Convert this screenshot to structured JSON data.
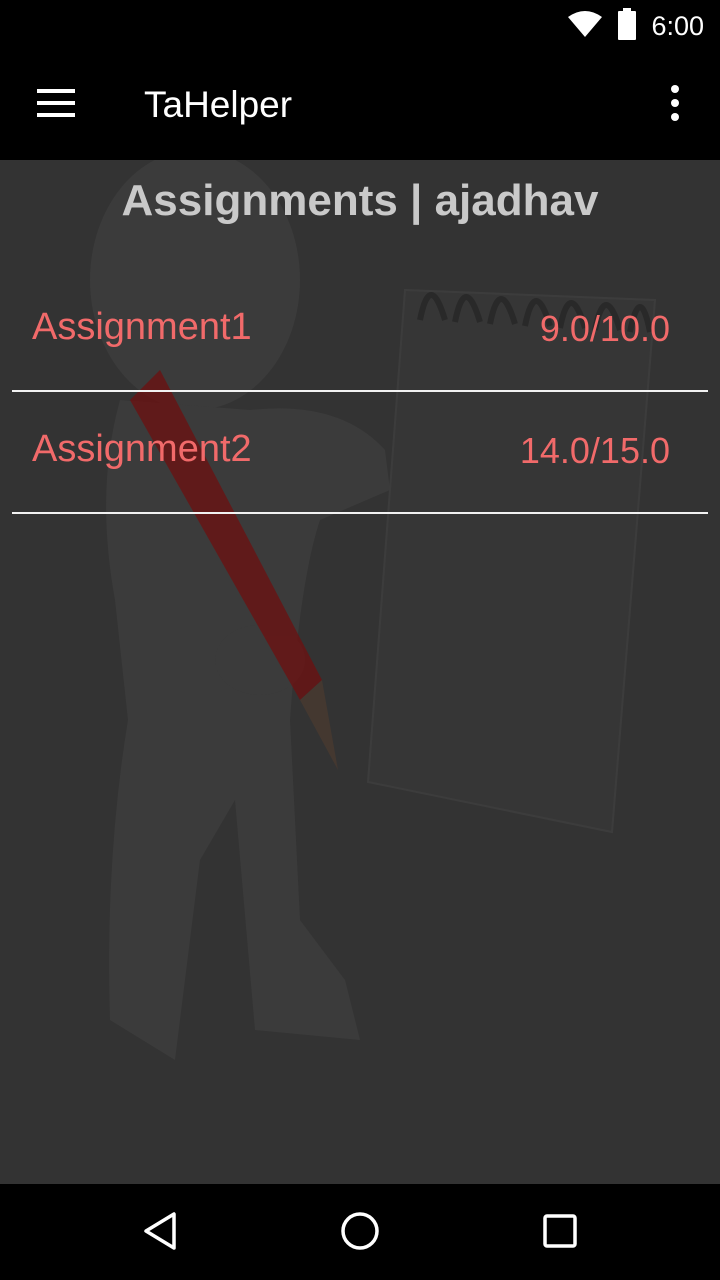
{
  "status_bar": {
    "time": "6:00",
    "icons": [
      "wifi-icon",
      "battery-icon"
    ]
  },
  "app_bar": {
    "title": "TaHelper",
    "menu_icon": "hamburger-menu-icon",
    "overflow_icon": "more-vert-icon"
  },
  "page": {
    "heading": "Assignments | ajadhav"
  },
  "assignments": [
    {
      "name": "Assignment1",
      "score": "9.0/10.0"
    },
    {
      "name": "Assignment2",
      "score": "14.0/15.0"
    }
  ],
  "nav_bar": {
    "icons": [
      "back-icon",
      "home-icon",
      "recents-icon"
    ]
  },
  "colors": {
    "accent": "#f16a6a",
    "content_bg": "#333333",
    "heading": "#c9c9c9"
  }
}
